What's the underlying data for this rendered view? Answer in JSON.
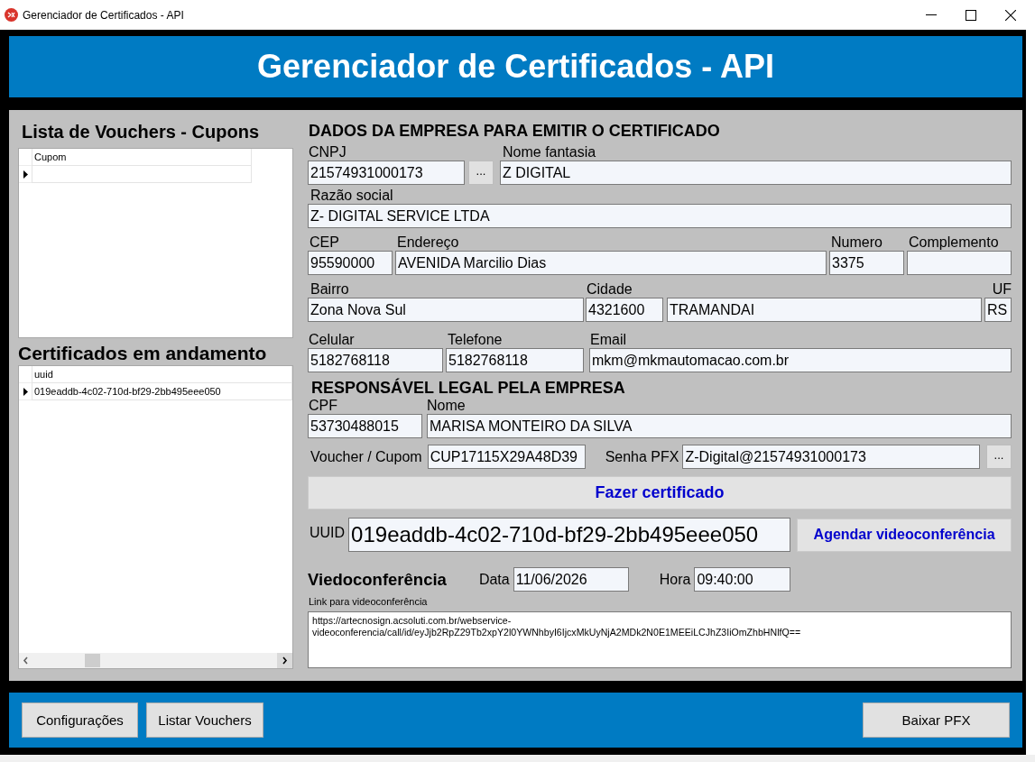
{
  "window": {
    "title": "Gerenciador de Certificados - API"
  },
  "header": {
    "title": "Gerenciador de Certificados - API"
  },
  "vouchers": {
    "title": "Lista de Vouchers - Cupons",
    "columns": [
      "Cupom"
    ],
    "rows": [
      {
        "current": true
      }
    ]
  },
  "certificates": {
    "title": "Certificados em andamento",
    "columns": [
      "uuid"
    ],
    "rows": [
      {
        "uuid": "019eaddb-4c02-710d-bf29-2bb495eee050",
        "current": true
      }
    ]
  },
  "company": {
    "title": "DADOS DA EMPRESA PARA EMITIR O CERTIFICADO",
    "cnpj": {
      "label": "CNPJ",
      "value": "21574931000173"
    },
    "cnpj_button": "...",
    "nome_fantasia": {
      "label": "Nome fantasia",
      "value": "Z DIGITAL"
    },
    "razao_social": {
      "label": "Razão social",
      "value": "Z- DIGITAL SERVICE LTDA"
    },
    "cep": {
      "label": "CEP",
      "value": "95590000"
    },
    "endereco": {
      "label": "Endereço",
      "value": "AVENIDA Marcilio Dias"
    },
    "numero": {
      "label": "Numero",
      "value": "3375"
    },
    "complemento": {
      "label": "Complemento"
    },
    "bairro": {
      "label": "Bairro",
      "value": "Zona Nova Sul"
    },
    "cidade": {
      "label": "Cidade",
      "value": "4321600"
    },
    "cidade_nome": {
      "value": "TRAMANDAI"
    },
    "uf": {
      "label": "UF",
      "value": "RS"
    },
    "celular": {
      "label": "Celular",
      "value": "5182768118"
    },
    "telefone": {
      "label": "Telefone",
      "value": "5182768118"
    },
    "email": {
      "label": "Email",
      "value": "mkm@mkmautomacao.com.br"
    }
  },
  "responsible": {
    "title": "RESPONSÁVEL LEGAL PELA EMPRESA",
    "cpf": {
      "label": "CPF",
      "value": "53730488015"
    },
    "nome": {
      "label": "Nome",
      "value": "MARISA MONTEIRO DA SILVA"
    },
    "voucher": {
      "label": "Voucher / Cupom",
      "value": "CUP17115X29A48D39"
    },
    "senha_pfx": {
      "label": "Senha PFX",
      "value": "Z-Digital@21574931000173"
    },
    "senha_button": "..."
  },
  "make_certificate_button": "Fazer certificado",
  "uuid": {
    "label": "UUID",
    "value": "019eaddb-4c02-710d-bf29-2bb495eee050"
  },
  "schedule_button": "Agendar videoconferência",
  "videoconference": {
    "title": "Viedoconferência",
    "data": {
      "label": "Data",
      "value": "11/06/2026"
    },
    "hora": {
      "label": "Hora",
      "value": "09:40:00"
    },
    "link": {
      "label": "Link para videoconferência",
      "value": "https://artecnosign.acsoluti.com.br/webservice-videoconferencia/call/id/eyJjb2RpZ29Tb2xpY2l0YWNhbyI6IjcxMkUyNjA2MDk2N0E1MEEiLCJhZ3IiOmZhbHNlfQ=="
    }
  },
  "footer": {
    "left_buttons": [
      "Configurações",
      "Listar Vouchers"
    ],
    "right_buttons": [
      "Baixar PFX"
    ]
  }
}
